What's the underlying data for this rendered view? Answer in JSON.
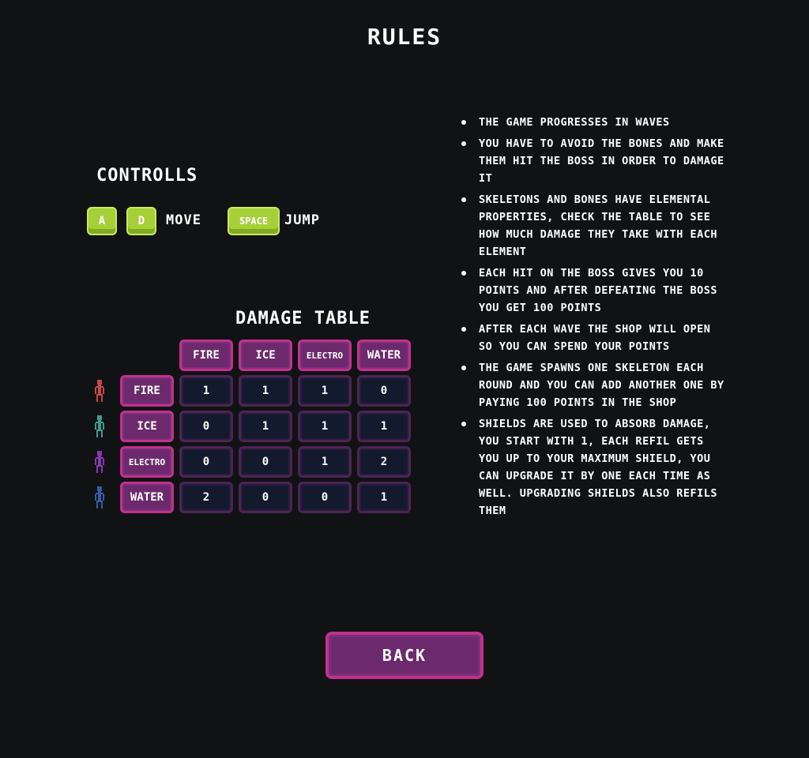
{
  "title": "RULES",
  "controls": {
    "heading": "CONTROLLS",
    "key_a": "A",
    "key_d": "D",
    "move_label": "MOVE",
    "key_space": "SPACE",
    "jump_label": "JUMP"
  },
  "damage_table": {
    "heading": "DAMAGE TABLE",
    "columns": [
      "FIRE",
      "ICE",
      "ELECTRO",
      "WATER"
    ],
    "rows": [
      {
        "label": "FIRE",
        "skeleton_color": "#c94848",
        "values": [
          "1",
          "1",
          "1",
          "0"
        ]
      },
      {
        "label": "ICE",
        "skeleton_color": "#3f9b8f",
        "values": [
          "0",
          "1",
          "1",
          "1"
        ]
      },
      {
        "label": "ELECTRO",
        "skeleton_color": "#8a35b5",
        "values": [
          "0",
          "0",
          "1",
          "2"
        ]
      },
      {
        "label": "WATER",
        "skeleton_color": "#2f5fa6",
        "values": [
          "2",
          "0",
          "0",
          "1"
        ]
      }
    ]
  },
  "rules": [
    "THE GAME PROGRESSES IN WAVES",
    "YOU HAVE TO AVOID THE BONES AND MAKE THEM HIT THE BOSS IN ORDER TO DAMAGE IT",
    "SKELETONS AND BONES HAVE ELEMENTAL PROPERTIES, CHECK THE TABLE TO SEE HOW MUCH DAMAGE THEY TAKE WITH EACH ELEMENT",
    "EACH HIT ON THE BOSS GIVES YOU 10 POINTS AND AFTER DEFEATING THE BOSS YOU GET 100 POINTS",
    "AFTER EACH WAVE THE SHOP WILL OPEN SO YOU CAN SPEND YOUR POINTS",
    "THE GAME SPAWNS ONE SKELETON EACH ROUND AND YOU CAN ADD ANOTHER ONE BY PAYING 100 POINTS IN THE SHOP",
    "SHIELDS ARE USED TO ABSORB DAMAGE, YOU START WITH 1, EACH REFIL GETS YOU UP TO YOUR MAXIMUM SHIELD, YOU CAN UPGRADE IT BY ONE EACH TIME AS WELL. UPGRADING SHIELDS ALSO REFILS THEM"
  ],
  "back_label": "BACK",
  "colors": {
    "background": "#111214",
    "key_green": "#a6cf3a",
    "header_purple": "#6c2a6c",
    "header_border": "#c2318c",
    "cell_dark": "#141a2e"
  }
}
